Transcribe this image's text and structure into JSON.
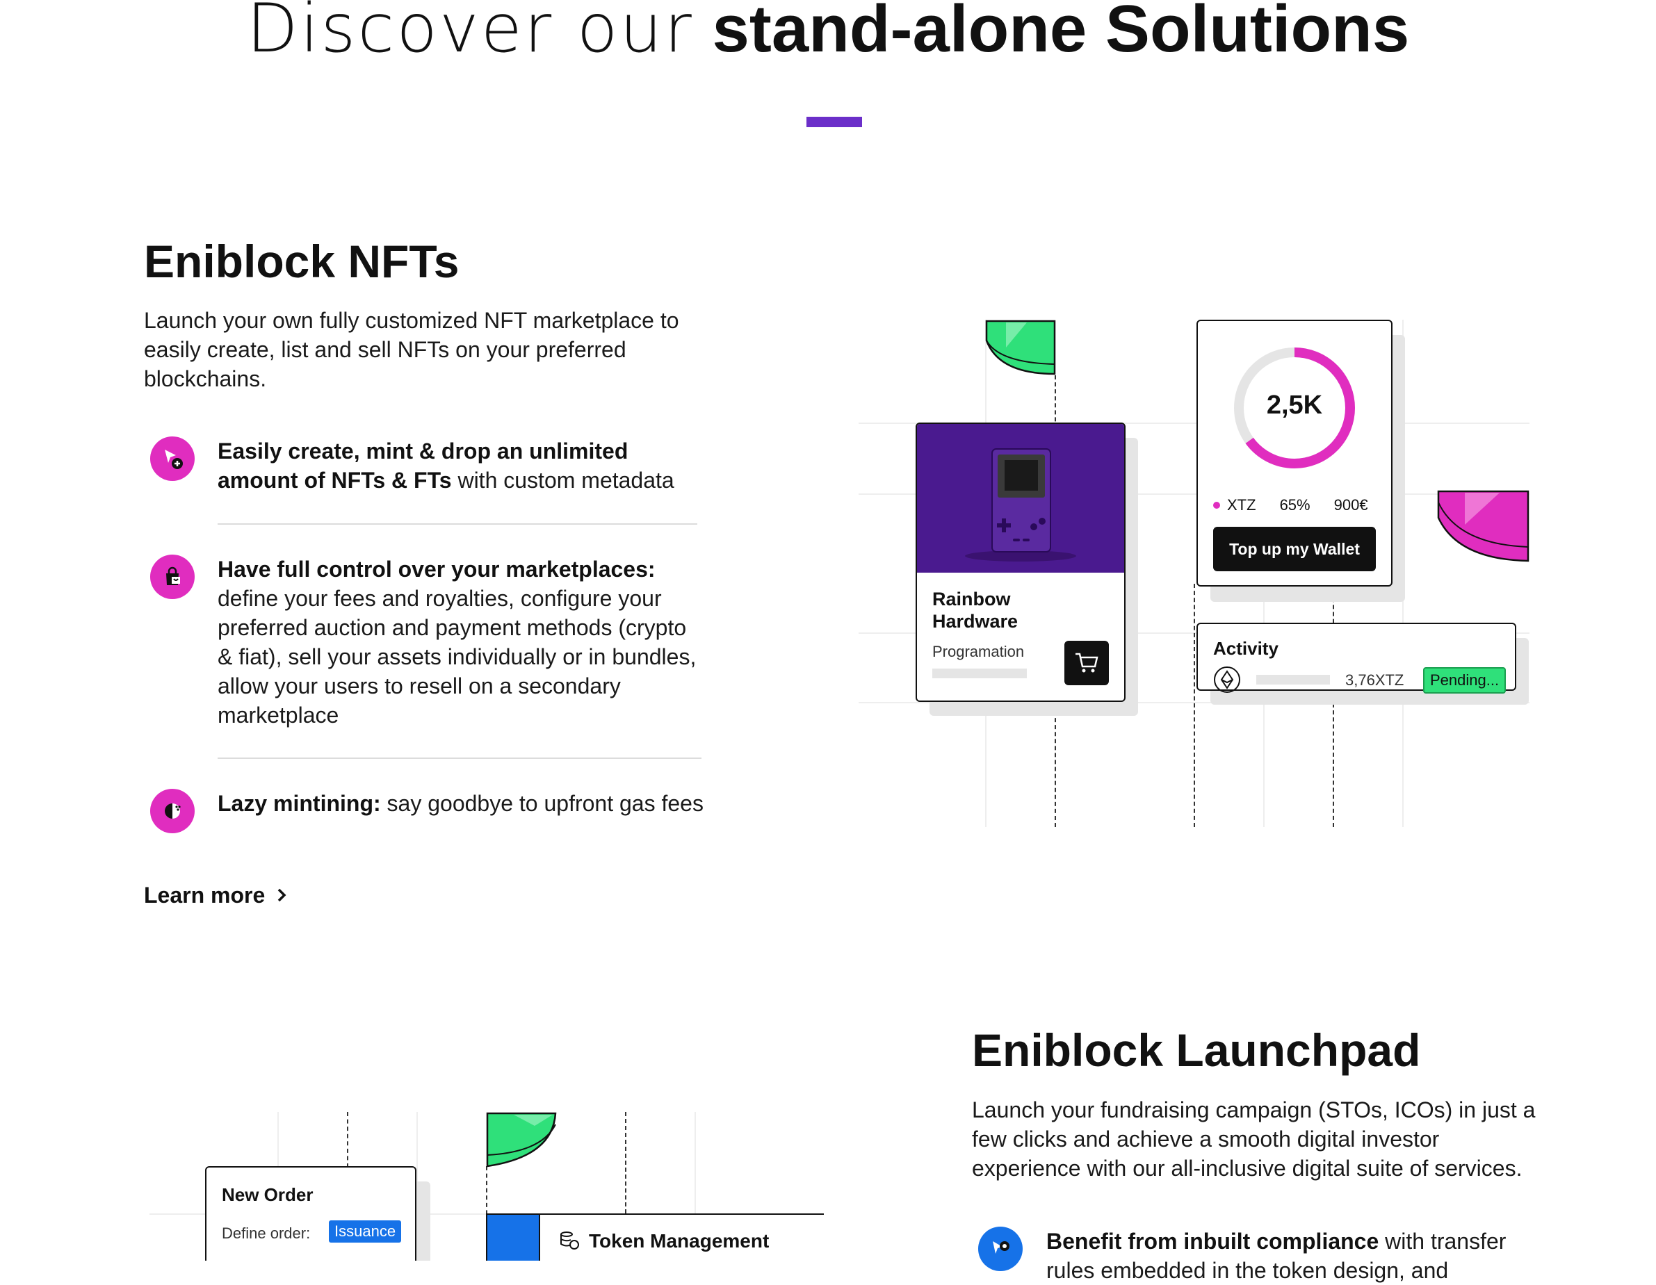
{
  "header": {
    "title_light": "Discover our",
    "title_bold": "stand-alone Solutions"
  },
  "nfts": {
    "title": "Eniblock NFTs",
    "description": "Launch your own fully customized NFT marketplace to easily create, list and sell NFTs on your preferred blockchains.",
    "features": [
      {
        "bold": "Easily create, mint & drop an unlimited amount of NFTs & FTs",
        "rest": " with custom metadata",
        "icon": "cursor-plus-icon"
      },
      {
        "bold": "Have full control over your marketplaces:",
        "rest": " define your fees and royalties, configure your preferred auction and payment methods (crypto & fiat), sell your assets individually or in bundles, allow your users to resell on a secondary marketplace",
        "icon": "shopping-bag-icon"
      },
      {
        "bold": "Lazy mintining:",
        "rest": " say goodbye to upfront gas fees",
        "icon": "half-circle-icon"
      }
    ],
    "learn_more": "Learn more"
  },
  "nft_illustration": {
    "product": {
      "name_line1": "Rainbow",
      "name_line2": "Hardware",
      "category": "Programation",
      "image_bg": "#4a1a8f"
    },
    "wallet": {
      "amount": "2,5K",
      "currency": "XTZ",
      "percent": "65%",
      "fiat": "900€",
      "button": "Top up my Wallet",
      "progress": 0.65,
      "ring_color": "#e02dbf"
    },
    "activity": {
      "title": "Activity",
      "amount": "3,76XTZ",
      "status": "Pending...",
      "status_color": "#2fe07a"
    },
    "colors": {
      "green": "#2fe07a",
      "pink": "#e02dbf"
    }
  },
  "launchpad": {
    "title": "Eniblock Launchpad",
    "description": "Launch your fundraising campaign (STOs, ICOs) in just a few clicks and achieve a smooth digital investor experience with our all-inclusive digital suite of services.",
    "features": [
      {
        "bold": "Benefit from inbuilt compliance",
        "rest": " with transfer rules embedded in the token design, and",
        "icon": "compliance-icon"
      }
    ]
  },
  "launchpad_illustration": {
    "order": {
      "title": "New Order",
      "label": "Define order:",
      "badge": "Issuance"
    },
    "token": {
      "title": "Token Management"
    },
    "colors": {
      "blue": "#1672e8",
      "green": "#2fe07a"
    }
  }
}
